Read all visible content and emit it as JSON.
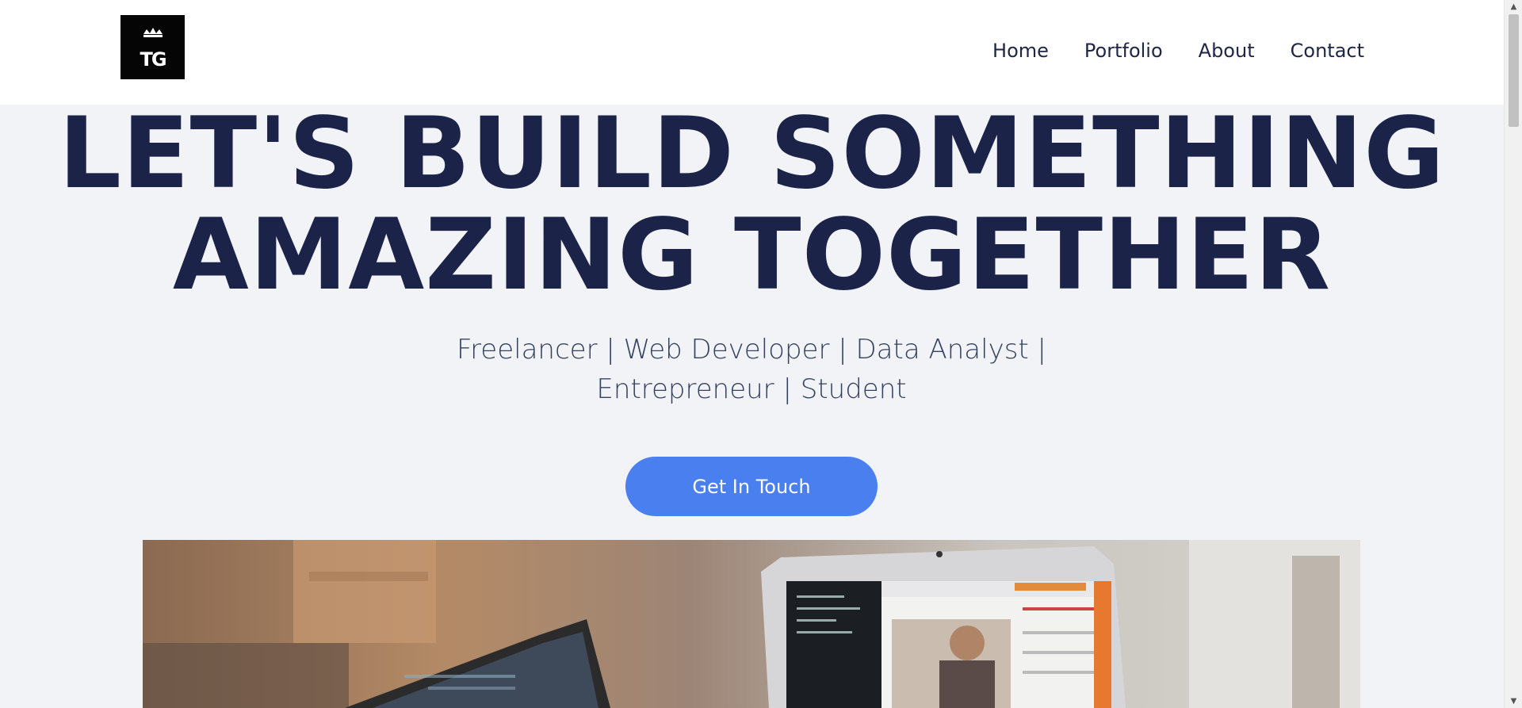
{
  "header": {
    "logo_text": "TG",
    "nav": [
      {
        "label": "Home"
      },
      {
        "label": "Portfolio"
      },
      {
        "label": "About"
      },
      {
        "label": "Contact"
      }
    ]
  },
  "hero": {
    "title_line1": "LET'S BUILD SOMETHING",
    "title_line2": "AMAZING TOGETHER",
    "subtitle_line1": "Freelancer | Web Developer | Data Analyst |",
    "subtitle_line2": "Entrepreneur | Student",
    "cta_label": "Get In Touch"
  },
  "colors": {
    "title": "#1c2349",
    "button": "#4a7ff0",
    "background": "#f2f3f7",
    "header": "#ffffff"
  },
  "icons": {
    "logo": "crown-logo-icon",
    "scroll_up": "triangle-up-icon",
    "scroll_down": "triangle-down-icon"
  }
}
